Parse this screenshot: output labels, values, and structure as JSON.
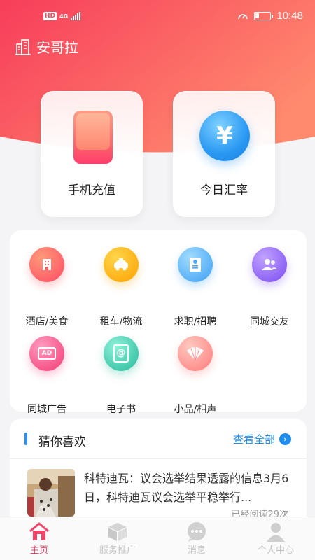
{
  "status_bar": {
    "hd": "HD",
    "network": "4G",
    "time": "10:48"
  },
  "header": {
    "location": "安哥拉"
  },
  "hero": {
    "cards": [
      {
        "label": "手机充值",
        "icon": "phone-icon"
      },
      {
        "label": "今日汇率",
        "icon": "yen-icon",
        "symbol": "¥"
      }
    ]
  },
  "services": [
    {
      "label": "酒店/美食",
      "icon": "hotel-icon",
      "color": "#ff5a5f"
    },
    {
      "label": "租车/物流",
      "icon": "taxi-icon",
      "color": "#ffb300"
    },
    {
      "label": "求职/招聘",
      "icon": "resume-icon",
      "color": "#4aa8f5"
    },
    {
      "label": "同城交友",
      "icon": "friends-icon",
      "color": "#8a5cf5"
    },
    {
      "label": "同城广告",
      "icon": "ad-icon",
      "ad_text": "AD",
      "color": "#f24f7d"
    },
    {
      "label": "电子书",
      "icon": "ebook-icon",
      "ebook_text": "@",
      "color": "#2ec9a7"
    },
    {
      "label": "小品/相声",
      "icon": "fan-icon",
      "color": "#ff8a8a"
    }
  ],
  "recommend": {
    "title": "猜你喜欢",
    "view_all": "查看全部",
    "article": {
      "title": "科特迪瓦：议会选举结果透露的信息3月6日，科特迪瓦议会选举平稳举行...",
      "meta": "已经阅读29次"
    }
  },
  "tabs": [
    {
      "label": "主页",
      "icon": "home-icon",
      "active": true
    },
    {
      "label": "服务推广",
      "icon": "box-icon",
      "active": false
    },
    {
      "label": "消息",
      "icon": "message-icon",
      "active": false
    },
    {
      "label": "个人中心",
      "icon": "user-icon",
      "active": false
    }
  ],
  "colors": {
    "brand_red": "#f8485e",
    "accent_blue": "#1f8ef0",
    "tab_active": "#f2436b"
  }
}
